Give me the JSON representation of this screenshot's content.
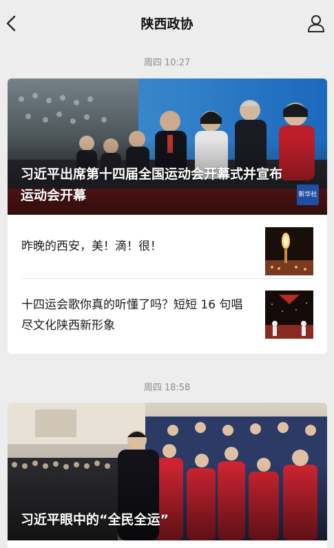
{
  "header": {
    "title": "陕西政协",
    "back_icon": "back-chevron-icon",
    "profile_icon": "person-icon"
  },
  "messages": [
    {
      "timestamp": "周四 10:27",
      "headline": {
        "title": "习近平出席第十四届全国运动会开幕式并宣布运动会开幕",
        "badge": "新华社"
      },
      "items": [
        {
          "title": "昨晚的西安，美！滴！很！"
        },
        {
          "title": "十四运会歌你真的听懂了吗？短短 16 句唱尽文化陕西新形象"
        }
      ]
    },
    {
      "timestamp": "周四 18:58",
      "headline": {
        "title": "习近平眼中的“全民全运”"
      }
    }
  ],
  "colors": {
    "background": "#ededed",
    "card": "#ffffff",
    "timestamp": "#8c8c8c",
    "badge": "#1e4fa3"
  }
}
